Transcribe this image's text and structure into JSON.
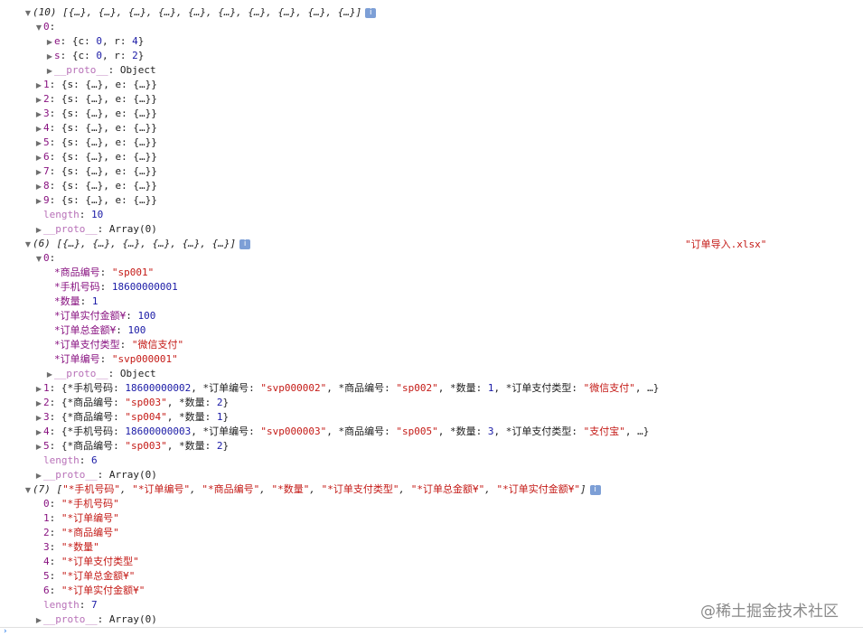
{
  "glyphs": {
    "expanded": "▼",
    "collapsed": "▶",
    "info": "i"
  },
  "lines": [
    {
      "indent": 0,
      "tri": "expanded",
      "info": true,
      "parts": [
        {
          "c": "ital",
          "t": "(10) [{…}, {…}, {…}, {…}, {…}, {…}, {…}, {…}, {…}, {…}]"
        }
      ]
    },
    {
      "indent": 1,
      "tri": "expanded",
      "parts": [
        {
          "c": "k",
          "t": "0"
        },
        {
          "c": "obj",
          "t": ":"
        }
      ]
    },
    {
      "indent": 2,
      "tri": "collapsed",
      "parts": [
        {
          "c": "k",
          "t": "e"
        },
        {
          "c": "obj",
          "t": ": {c: "
        },
        {
          "c": "num",
          "t": "0"
        },
        {
          "c": "obj",
          "t": ", r: "
        },
        {
          "c": "num",
          "t": "4"
        },
        {
          "c": "obj",
          "t": "}"
        }
      ]
    },
    {
      "indent": 2,
      "tri": "collapsed",
      "parts": [
        {
          "c": "k",
          "t": "s"
        },
        {
          "c": "obj",
          "t": ": {c: "
        },
        {
          "c": "num",
          "t": "0"
        },
        {
          "c": "obj",
          "t": ", r: "
        },
        {
          "c": "num",
          "t": "2"
        },
        {
          "c": "obj",
          "t": "}"
        }
      ]
    },
    {
      "indent": 2,
      "tri": "collapsed",
      "parts": [
        {
          "c": "kd",
          "t": "__proto__"
        },
        {
          "c": "obj",
          "t": ": Object"
        }
      ]
    },
    {
      "indent": 1,
      "tri": "collapsed",
      "parts": [
        {
          "c": "k",
          "t": "1"
        },
        {
          "c": "obj",
          "t": ": {s: {…}, e: {…}}"
        }
      ]
    },
    {
      "indent": 1,
      "tri": "collapsed",
      "parts": [
        {
          "c": "k",
          "t": "2"
        },
        {
          "c": "obj",
          "t": ": {s: {…}, e: {…}}"
        }
      ]
    },
    {
      "indent": 1,
      "tri": "collapsed",
      "parts": [
        {
          "c": "k",
          "t": "3"
        },
        {
          "c": "obj",
          "t": ": {s: {…}, e: {…}}"
        }
      ]
    },
    {
      "indent": 1,
      "tri": "collapsed",
      "parts": [
        {
          "c": "k",
          "t": "4"
        },
        {
          "c": "obj",
          "t": ": {s: {…}, e: {…}}"
        }
      ]
    },
    {
      "indent": 1,
      "tri": "collapsed",
      "parts": [
        {
          "c": "k",
          "t": "5"
        },
        {
          "c": "obj",
          "t": ": {s: {…}, e: {…}}"
        }
      ]
    },
    {
      "indent": 1,
      "tri": "collapsed",
      "parts": [
        {
          "c": "k",
          "t": "6"
        },
        {
          "c": "obj",
          "t": ": {s: {…}, e: {…}}"
        }
      ]
    },
    {
      "indent": 1,
      "tri": "collapsed",
      "parts": [
        {
          "c": "k",
          "t": "7"
        },
        {
          "c": "obj",
          "t": ": {s: {…}, e: {…}}"
        }
      ]
    },
    {
      "indent": 1,
      "tri": "collapsed",
      "parts": [
        {
          "c": "k",
          "t": "8"
        },
        {
          "c": "obj",
          "t": ": {s: {…}, e: {…}}"
        }
      ]
    },
    {
      "indent": 1,
      "tri": "collapsed",
      "parts": [
        {
          "c": "k",
          "t": "9"
        },
        {
          "c": "obj",
          "t": ": {s: {…}, e: {…}}"
        }
      ]
    },
    {
      "indent": 1,
      "tri": "none",
      "parts": [
        {
          "c": "kd",
          "t": "length"
        },
        {
          "c": "obj",
          "t": ": "
        },
        {
          "c": "num",
          "t": "10"
        }
      ]
    },
    {
      "indent": 1,
      "tri": "collapsed",
      "parts": [
        {
          "c": "kd",
          "t": "__proto__"
        },
        {
          "c": "obj",
          "t": ": Array(0)"
        }
      ]
    },
    {
      "indent": 0,
      "tri": "expanded",
      "info": true,
      "parts": [
        {
          "c": "ital",
          "t": "(6) [{…}, {…}, {…}, {…}, {…}, {…}]"
        }
      ]
    },
    {
      "indent": 1,
      "tri": "expanded",
      "parts": [
        {
          "c": "k",
          "t": "0"
        },
        {
          "c": "obj",
          "t": ":"
        }
      ]
    },
    {
      "indent": 2,
      "tri": "none",
      "parts": [
        {
          "c": "k",
          "t": "*商品编号"
        },
        {
          "c": "obj",
          "t": ": "
        },
        {
          "c": "str",
          "t": "\"sp001\""
        }
      ]
    },
    {
      "indent": 2,
      "tri": "none",
      "parts": [
        {
          "c": "k",
          "t": "*手机号码"
        },
        {
          "c": "obj",
          "t": ": "
        },
        {
          "c": "num",
          "t": "18600000001"
        }
      ]
    },
    {
      "indent": 2,
      "tri": "none",
      "parts": [
        {
          "c": "k",
          "t": "*数量"
        },
        {
          "c": "obj",
          "t": ": "
        },
        {
          "c": "num",
          "t": "1"
        }
      ]
    },
    {
      "indent": 2,
      "tri": "none",
      "parts": [
        {
          "c": "k",
          "t": "*订单实付金额¥"
        },
        {
          "c": "obj",
          "t": ": "
        },
        {
          "c": "num",
          "t": "100"
        }
      ]
    },
    {
      "indent": 2,
      "tri": "none",
      "parts": [
        {
          "c": "k",
          "t": "*订单总金额¥"
        },
        {
          "c": "obj",
          "t": ": "
        },
        {
          "c": "num",
          "t": "100"
        }
      ]
    },
    {
      "indent": 2,
      "tri": "none",
      "parts": [
        {
          "c": "k",
          "t": "*订单支付类型"
        },
        {
          "c": "obj",
          "t": ": "
        },
        {
          "c": "str",
          "t": "\"微信支付\""
        }
      ]
    },
    {
      "indent": 2,
      "tri": "none",
      "parts": [
        {
          "c": "k",
          "t": "*订单编号"
        },
        {
          "c": "obj",
          "t": ": "
        },
        {
          "c": "str",
          "t": "\"svp000001\""
        }
      ]
    },
    {
      "indent": 2,
      "tri": "collapsed",
      "parts": [
        {
          "c": "kd",
          "t": "__proto__"
        },
        {
          "c": "obj",
          "t": ": Object"
        }
      ]
    },
    {
      "indent": 1,
      "tri": "collapsed",
      "parts": [
        {
          "c": "k",
          "t": "1"
        },
        {
          "c": "obj",
          "t": ": {*手机号码: "
        },
        {
          "c": "num",
          "t": "18600000002"
        },
        {
          "c": "obj",
          "t": ", *订单编号: "
        },
        {
          "c": "str",
          "t": "\"svp000002\""
        },
        {
          "c": "obj",
          "t": ", *商品编号: "
        },
        {
          "c": "str",
          "t": "\"sp002\""
        },
        {
          "c": "obj",
          "t": ", *数量: "
        },
        {
          "c": "num",
          "t": "1"
        },
        {
          "c": "obj",
          "t": ", *订单支付类型: "
        },
        {
          "c": "str",
          "t": "\"微信支付\""
        },
        {
          "c": "obj",
          "t": ", …}"
        }
      ]
    },
    {
      "indent": 1,
      "tri": "collapsed",
      "parts": [
        {
          "c": "k",
          "t": "2"
        },
        {
          "c": "obj",
          "t": ": {*商品编号: "
        },
        {
          "c": "str",
          "t": "\"sp003\""
        },
        {
          "c": "obj",
          "t": ", *数量: "
        },
        {
          "c": "num",
          "t": "2"
        },
        {
          "c": "obj",
          "t": "}"
        }
      ]
    },
    {
      "indent": 1,
      "tri": "collapsed",
      "parts": [
        {
          "c": "k",
          "t": "3"
        },
        {
          "c": "obj",
          "t": ": {*商品编号: "
        },
        {
          "c": "str",
          "t": "\"sp004\""
        },
        {
          "c": "obj",
          "t": ", *数量: "
        },
        {
          "c": "num",
          "t": "1"
        },
        {
          "c": "obj",
          "t": "}"
        }
      ]
    },
    {
      "indent": 1,
      "tri": "collapsed",
      "parts": [
        {
          "c": "k",
          "t": "4"
        },
        {
          "c": "obj",
          "t": ": {*手机号码: "
        },
        {
          "c": "num",
          "t": "18600000003"
        },
        {
          "c": "obj",
          "t": ", *订单编号: "
        },
        {
          "c": "str",
          "t": "\"svp000003\""
        },
        {
          "c": "obj",
          "t": ", *商品编号: "
        },
        {
          "c": "str",
          "t": "\"sp005\""
        },
        {
          "c": "obj",
          "t": ", *数量: "
        },
        {
          "c": "num",
          "t": "3"
        },
        {
          "c": "obj",
          "t": ", *订单支付类型: "
        },
        {
          "c": "str",
          "t": "\"支付宝\""
        },
        {
          "c": "obj",
          "t": ", …}"
        }
      ]
    },
    {
      "indent": 1,
      "tri": "collapsed",
      "parts": [
        {
          "c": "k",
          "t": "5"
        },
        {
          "c": "obj",
          "t": ": {*商品编号: "
        },
        {
          "c": "str",
          "t": "\"sp003\""
        },
        {
          "c": "obj",
          "t": ", *数量: "
        },
        {
          "c": "num",
          "t": "2"
        },
        {
          "c": "obj",
          "t": "}"
        }
      ]
    },
    {
      "indent": 1,
      "tri": "none",
      "parts": [
        {
          "c": "kd",
          "t": "length"
        },
        {
          "c": "obj",
          "t": ": "
        },
        {
          "c": "num",
          "t": "6"
        }
      ]
    },
    {
      "indent": 1,
      "tri": "collapsed",
      "parts": [
        {
          "c": "kd",
          "t": "__proto__"
        },
        {
          "c": "obj",
          "t": ": Array(0)"
        }
      ]
    },
    {
      "indent": 0,
      "tri": "expanded",
      "info": true,
      "parts": [
        {
          "c": "ital",
          "t": "(7) ["
        },
        {
          "c": "str",
          "t": "\"*手机号码\""
        },
        {
          "c": "ital",
          "t": ", "
        },
        {
          "c": "str",
          "t": "\"*订单编号\""
        },
        {
          "c": "ital",
          "t": ", "
        },
        {
          "c": "str",
          "t": "\"*商品编号\""
        },
        {
          "c": "ital",
          "t": ", "
        },
        {
          "c": "str",
          "t": "\"*数量\""
        },
        {
          "c": "ital",
          "t": ", "
        },
        {
          "c": "str",
          "t": "\"*订单支付类型\""
        },
        {
          "c": "ital",
          "t": ", "
        },
        {
          "c": "str",
          "t": "\"*订单总金额¥\""
        },
        {
          "c": "ital",
          "t": ", "
        },
        {
          "c": "str",
          "t": "\"*订单实付金额¥\""
        },
        {
          "c": "ital",
          "t": "]"
        }
      ]
    },
    {
      "indent": 1,
      "tri": "none",
      "parts": [
        {
          "c": "k",
          "t": "0"
        },
        {
          "c": "obj",
          "t": ": "
        },
        {
          "c": "str",
          "t": "\"*手机号码\""
        }
      ]
    },
    {
      "indent": 1,
      "tri": "none",
      "parts": [
        {
          "c": "k",
          "t": "1"
        },
        {
          "c": "obj",
          "t": ": "
        },
        {
          "c": "str",
          "t": "\"*订单编号\""
        }
      ]
    },
    {
      "indent": 1,
      "tri": "none",
      "parts": [
        {
          "c": "k",
          "t": "2"
        },
        {
          "c": "obj",
          "t": ": "
        },
        {
          "c": "str",
          "t": "\"*商品编号\""
        }
      ]
    },
    {
      "indent": 1,
      "tri": "none",
      "parts": [
        {
          "c": "k",
          "t": "3"
        },
        {
          "c": "obj",
          "t": ": "
        },
        {
          "c": "str",
          "t": "\"*数量\""
        }
      ]
    },
    {
      "indent": 1,
      "tri": "none",
      "parts": [
        {
          "c": "k",
          "t": "4"
        },
        {
          "c": "obj",
          "t": ": "
        },
        {
          "c": "str",
          "t": "\"*订单支付类型\""
        }
      ]
    },
    {
      "indent": 1,
      "tri": "none",
      "parts": [
        {
          "c": "k",
          "t": "5"
        },
        {
          "c": "obj",
          "t": ": "
        },
        {
          "c": "str",
          "t": "\"*订单总金额¥\""
        }
      ]
    },
    {
      "indent": 1,
      "tri": "none",
      "parts": [
        {
          "c": "k",
          "t": "6"
        },
        {
          "c": "obj",
          "t": ": "
        },
        {
          "c": "str",
          "t": "\"*订单实付金额¥\""
        }
      ]
    },
    {
      "indent": 1,
      "tri": "none",
      "parts": [
        {
          "c": "kd",
          "t": "length"
        },
        {
          "c": "obj",
          "t": ": "
        },
        {
          "c": "num",
          "t": "7"
        }
      ]
    },
    {
      "indent": 1,
      "tri": "collapsed",
      "parts": [
        {
          "c": "kd",
          "t": "__proto__"
        },
        {
          "c": "obj",
          "t": ": Array(0)"
        }
      ]
    }
  ],
  "file_log": "\"订单导入.xlsx\"",
  "watermark": "@稀土掘金技术社区",
  "prompt_glyph": "›",
  "colors": {
    "key": "#881280",
    "dim_key": "#b871b8",
    "number": "#1a1aa6",
    "string": "#c41a16",
    "info_badge": "#7d9fd6"
  }
}
